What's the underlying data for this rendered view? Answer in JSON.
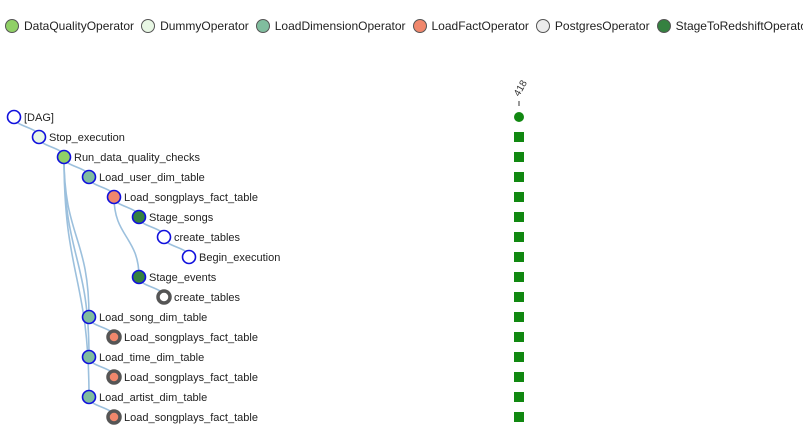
{
  "legend": {
    "items": [
      {
        "label": "DataQualityOperator",
        "color": "#90d066"
      },
      {
        "label": "DummyOperator",
        "color": "#e8f7e4"
      },
      {
        "label": "LoadDimensionOperator",
        "color": "#80bd9e"
      },
      {
        "label": "LoadFactOperator",
        "color": "#f0876c"
      },
      {
        "label": "PostgresOperator",
        "color": "#ececec"
      },
      {
        "label": "StageToRedshiftOperator",
        "color": "#358140"
      }
    ]
  },
  "run": {
    "id_label": "418",
    "status_color": "#118811"
  },
  "tasks": [
    {
      "label": "[DAG]",
      "depth": 0,
      "parent": null,
      "fill": "#ffffff",
      "border": "#1010dd",
      "thick": false,
      "task_state": "circle"
    },
    {
      "label": "Stop_execution",
      "depth": 1,
      "parent": 0,
      "fill": "#e8f7e4",
      "border": "#1010dd",
      "thick": false,
      "task_state": "square"
    },
    {
      "label": "Run_data_quality_checks",
      "depth": 2,
      "parent": 1,
      "fill": "#90d066",
      "border": "#1010dd",
      "thick": false,
      "task_state": "square"
    },
    {
      "label": "Load_user_dim_table",
      "depth": 3,
      "parent": 2,
      "fill": "#80bd9e",
      "border": "#1010dd",
      "thick": false,
      "task_state": "square"
    },
    {
      "label": "Load_songplays_fact_table",
      "depth": 4,
      "parent": 3,
      "fill": "#f0876c",
      "border": "#1010dd",
      "thick": false,
      "task_state": "square"
    },
    {
      "label": "Stage_songs",
      "depth": 5,
      "parent": 4,
      "fill": "#358140",
      "border": "#1010dd",
      "thick": false,
      "task_state": "square"
    },
    {
      "label": "create_tables",
      "depth": 6,
      "parent": 5,
      "fill": "#ffffff",
      "border": "#1010dd",
      "thick": false,
      "task_state": "square"
    },
    {
      "label": "Begin_execution",
      "depth": 7,
      "parent": 6,
      "fill": "#ffffff",
      "border": "#1010dd",
      "thick": false,
      "task_state": "square"
    },
    {
      "label": "Stage_events",
      "depth": 5,
      "parent": 4,
      "fill": "#358140",
      "border": "#1010dd",
      "thick": false,
      "task_state": "square"
    },
    {
      "label": "create_tables",
      "depth": 6,
      "parent": 8,
      "fill": "#ffffff",
      "border": "#555555",
      "thick": true,
      "task_state": "square"
    },
    {
      "label": "Load_song_dim_table",
      "depth": 3,
      "parent": 2,
      "fill": "#80bd9e",
      "border": "#1010dd",
      "thick": false,
      "task_state": "square"
    },
    {
      "label": "Load_songplays_fact_table",
      "depth": 4,
      "parent": 10,
      "fill": "#f0876c",
      "border": "#555555",
      "thick": true,
      "task_state": "square"
    },
    {
      "label": "Load_time_dim_table",
      "depth": 3,
      "parent": 2,
      "fill": "#80bd9e",
      "border": "#1010dd",
      "thick": false,
      "task_state": "square"
    },
    {
      "label": "Load_songplays_fact_table",
      "depth": 4,
      "parent": 12,
      "fill": "#f0876c",
      "border": "#555555",
      "thick": true,
      "task_state": "square"
    },
    {
      "label": "Load_artist_dim_table",
      "depth": 3,
      "parent": 2,
      "fill": "#80bd9e",
      "border": "#1010dd",
      "thick": false,
      "task_state": "square"
    },
    {
      "label": "Load_songplays_fact_table",
      "depth": 4,
      "parent": 14,
      "fill": "#f0876c",
      "border": "#555555",
      "thick": true,
      "task_state": "square"
    }
  ]
}
